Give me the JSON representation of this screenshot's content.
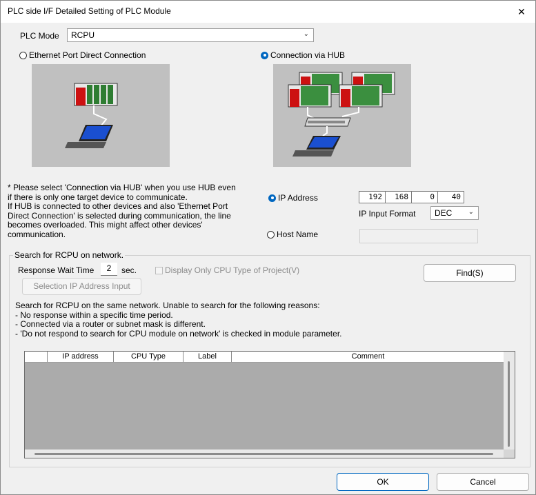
{
  "window": {
    "title": "PLC side I/F Detailed Setting of PLC Module",
    "close_glyph": "✕"
  },
  "plc_mode": {
    "label": "PLC Mode",
    "value": "RCPU"
  },
  "connection": {
    "direct_label": "Ethernet Port Direct Connection",
    "hub_label": "Connection via HUB",
    "selected": "hub"
  },
  "note": {
    "lines": [
      "* Please select 'Connection via HUB' when you use HUB even",
      "if there is only one target device to communicate.",
      "If HUB is connected to other devices and also 'Ethernet Port",
      "Direct Connection' is selected during communication, the line",
      "becomes overloaded. This might affect other devices'",
      "communication."
    ]
  },
  "target": {
    "ip_label": "IP Address",
    "ip_octets": [
      "192",
      "168",
      "0",
      "40"
    ],
    "ip_format_label": "IP Input Format",
    "ip_format_value": "DEC",
    "host_label": "Host Name",
    "host_value": "",
    "selected": "ip"
  },
  "search": {
    "group_label": "Search for RCPU on network.",
    "wait_label": "Response Wait Time",
    "wait_value": "2",
    "wait_unit": "sec.",
    "display_only_label": "Display Only CPU Type of Project(V)",
    "find_button": "Find(S)",
    "selection_button": "Selection IP Address Input",
    "info_lines": [
      "Search for RCPU on the same network. Unable to search for the following reasons:",
      "- No response within a specific time period.",
      "- Connected via a router or subnet mask is different.",
      "- 'Do not respond to search for CPU module on network' is checked in module parameter."
    ],
    "columns": [
      "",
      "IP address",
      "CPU Type",
      "Label",
      "Comment"
    ]
  },
  "footer": {
    "ok": "OK",
    "cancel": "Cancel"
  },
  "icons": {
    "close": "close-icon",
    "chevron": "chevron-down-icon"
  },
  "colors": {
    "accent": "#0067c0",
    "image_bg": "#c0c0c0",
    "table_bg": "#ababab"
  }
}
